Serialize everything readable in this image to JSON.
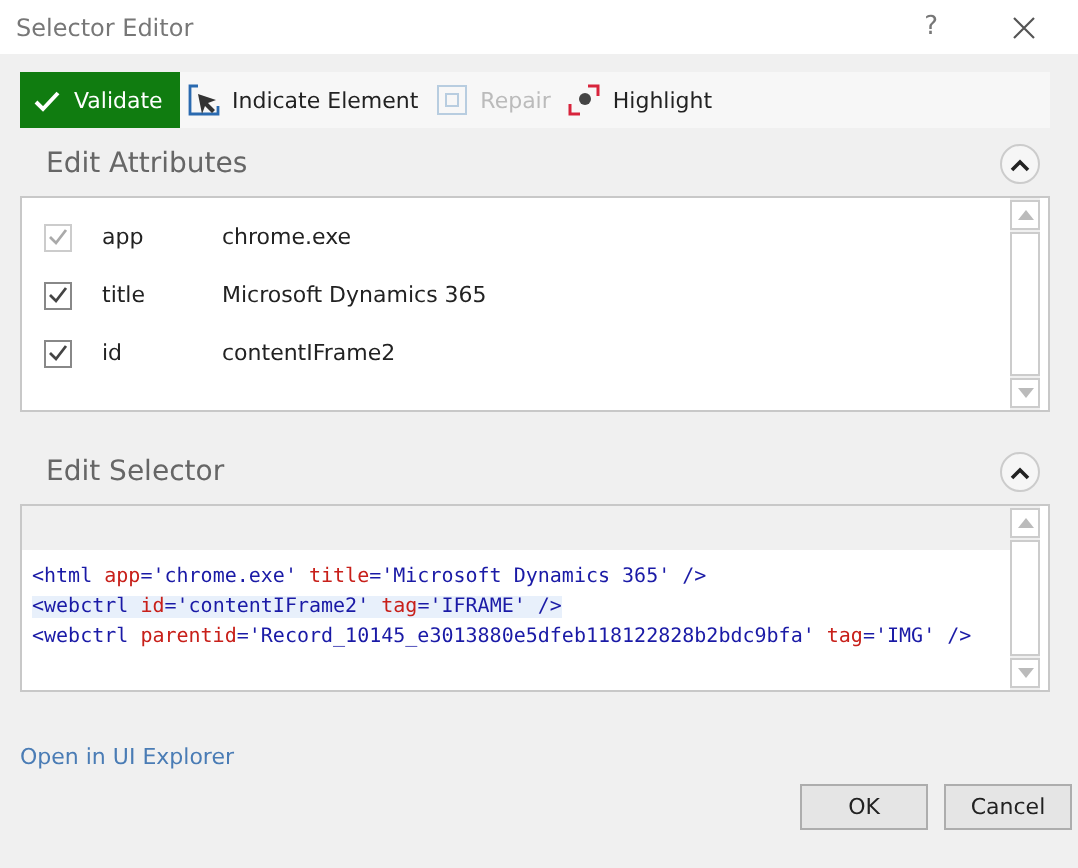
{
  "window": {
    "title": "Selector Editor",
    "help": "?"
  },
  "toolbar": [
    {
      "kind": "validate",
      "label": "Validate",
      "disabled": false
    },
    {
      "kind": "indicate",
      "label": "Indicate Element",
      "disabled": false
    },
    {
      "kind": "repair",
      "label": "Repair",
      "disabled": true
    },
    {
      "kind": "highlight",
      "label": "Highlight",
      "disabled": false
    }
  ],
  "attributes": {
    "title": "Edit Attributes",
    "expanded": true,
    "rows": [
      {
        "name": "app",
        "value": "chrome.exe",
        "checked": true,
        "disabled": true
      },
      {
        "name": "title",
        "value": "Microsoft Dynamics 365",
        "checked": true,
        "disabled": false
      },
      {
        "name": "id",
        "value": "contentIFrame2",
        "checked": true,
        "disabled": false
      }
    ]
  },
  "selector": {
    "title": "Edit Selector",
    "expanded": true,
    "lines": [
      {
        "selected": false,
        "tokens": [
          {
            "kind": "punct",
            "text": "<html "
          },
          {
            "kind": "attr",
            "text": "app"
          },
          {
            "kind": "punct",
            "text": "="
          },
          {
            "kind": "value",
            "text": "'chrome.exe'"
          },
          {
            "kind": "attr",
            "text": " title"
          },
          {
            "kind": "punct",
            "text": "="
          },
          {
            "kind": "value",
            "text": "'Microsoft Dynamics 365'"
          },
          {
            "kind": "punct",
            "text": " />"
          }
        ]
      },
      {
        "selected": true,
        "tokens": [
          {
            "kind": "punct",
            "text": "<webctrl "
          },
          {
            "kind": "attr",
            "text": "id"
          },
          {
            "kind": "punct",
            "text": "="
          },
          {
            "kind": "value",
            "text": "'contentIFrame2'"
          },
          {
            "kind": "attr",
            "text": " tag"
          },
          {
            "kind": "punct",
            "text": "="
          },
          {
            "kind": "value",
            "text": "'IFRAME'"
          },
          {
            "kind": "punct",
            "text": " />"
          }
        ]
      },
      {
        "selected": false,
        "tokens": [
          {
            "kind": "punct",
            "text": "<webctrl "
          },
          {
            "kind": "attr",
            "text": "parentid"
          },
          {
            "kind": "punct",
            "text": "="
          },
          {
            "kind": "value",
            "text": "'Record_10145_e3013880e5dfeb118122828b2bdc9bfa'"
          },
          {
            "kind": "attr",
            "text": " tag"
          },
          {
            "kind": "punct",
            "text": "="
          },
          {
            "kind": "value",
            "text": "'IMG'"
          },
          {
            "kind": "punct",
            "text": " />"
          }
        ]
      }
    ]
  },
  "link": "Open in UI Explorer",
  "buttons": [
    "OK",
    "Cancel"
  ]
}
